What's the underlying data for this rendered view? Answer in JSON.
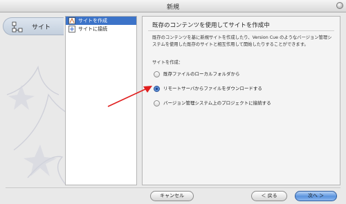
{
  "window": {
    "title": "新規"
  },
  "left_tab": {
    "label": "サイト",
    "icon": "site-network-icon"
  },
  "list": {
    "items": [
      {
        "label": "サイトを作成",
        "icon": "create-site-icon",
        "selected": true
      },
      {
        "label": "サイトに接続",
        "icon": "connect-site-icon",
        "selected": false
      }
    ]
  },
  "main": {
    "heading": "既存のコンテンツを使用してサイトを作成中",
    "description": "既存のコンテンツを基に新規サイトを作成したり、Version Cue のようなバージョン管理システムを使用した既存のサイトと相互作用して開始したりすることができます。",
    "group_label": "サイトを作成：",
    "options": [
      {
        "label": "既存ファイルのローカルフォルダから",
        "checked": false
      },
      {
        "label": "リモートサーバからファイルをダウンロードする",
        "checked": true
      },
      {
        "label": "バージョン管理システム上のプロジェクトに接続する",
        "checked": false
      }
    ]
  },
  "buttons": {
    "cancel": "キャンセル",
    "back": "＜ 戻る",
    "next": "次へ ＞"
  },
  "colors": {
    "selection": "#3c73c8",
    "arrow": "#e01e1e",
    "primary_button": "#5b94de"
  }
}
